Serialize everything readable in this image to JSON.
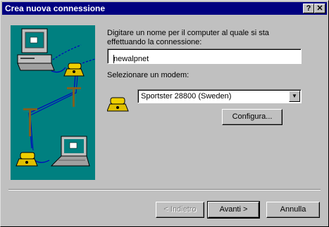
{
  "window": {
    "title": "Crea nuova connessione"
  },
  "titlebar_buttons": {
    "help": "?",
    "close": "✕"
  },
  "form": {
    "name_label_line1": "Digitare un nome per il computer al quale si sta",
    "name_label_line2": "effettuando la connessione:",
    "name_value": "newalpnet",
    "modem_label": "Selezionare un modem:",
    "modem_value": "Sportster 28800 (Sweden)",
    "configure_label": "Configura..."
  },
  "footer": {
    "back_label": "< Indietro",
    "next_label": "Avanti >",
    "cancel_label": "Annulla"
  },
  "colors": {
    "titlebar": "#000080",
    "illustration_bg": "#008080",
    "face": "#c0c0c0"
  },
  "icons": [
    "computer-icon",
    "telephone-icon",
    "laptop-icon",
    "modem-telephone-icon",
    "help-icon",
    "close-icon",
    "dropdown-arrow-icon"
  ]
}
